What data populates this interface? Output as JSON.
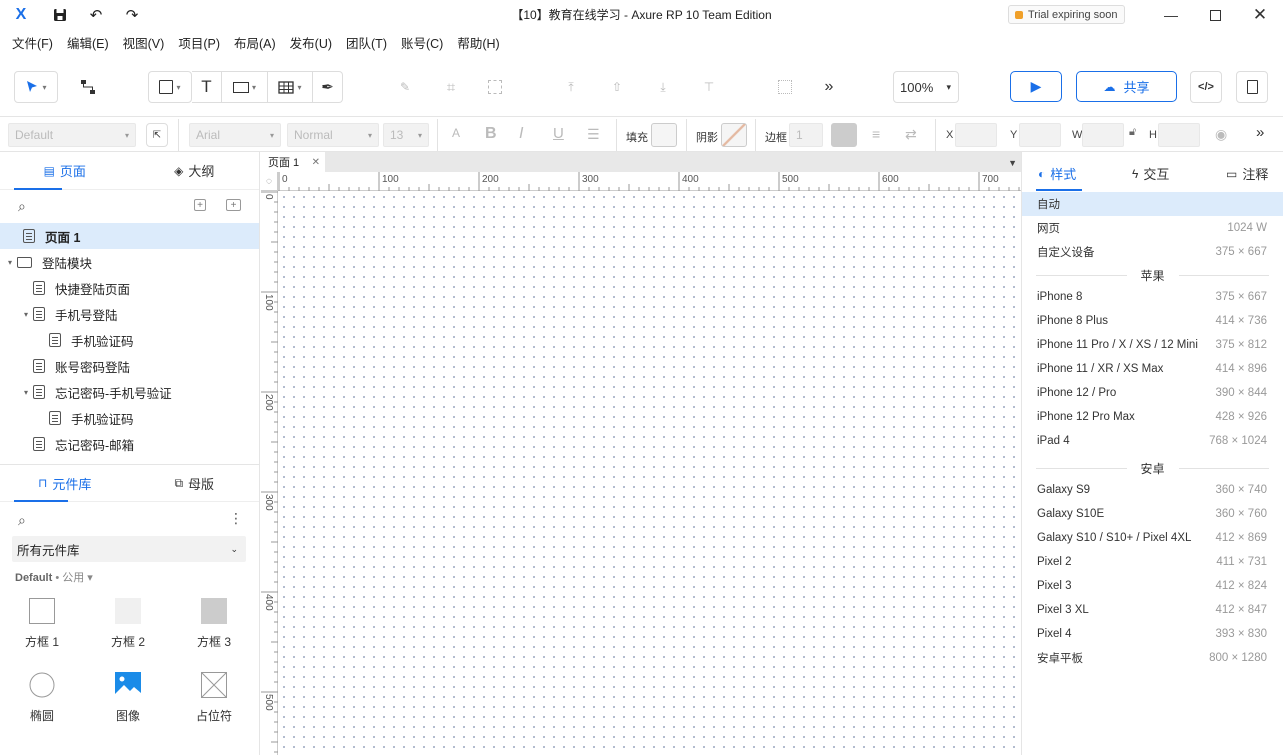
{
  "window": {
    "logo": "X",
    "title": "【10】教育在线学习 - Axure RP 10 Team Edition",
    "trial": "Trial expiring soon",
    "icons": {
      "save": "save-icon",
      "undo": "undo-icon",
      "redo": "redo-icon",
      "minimize": "minimize-icon",
      "maximize": "maximize-icon",
      "close": "close-icon"
    }
  },
  "menu": [
    "文件(F)",
    "编辑(E)",
    "视图(V)",
    "项目(P)",
    "布局(A)",
    "发布(U)",
    "团队(T)",
    "账号(C)",
    "帮助(H)"
  ],
  "toolbar": {
    "more": "»",
    "zoom": "100%",
    "share": "共享"
  },
  "stylebar": {
    "style_select": "Default",
    "font": "Arial",
    "weight": "Normal",
    "size": "13",
    "fill_label": "填充",
    "shadow_label": "阴影",
    "border_label": "边框",
    "border_value": "1",
    "x_label": "X",
    "y_label": "Y",
    "w_label": "W",
    "h_label": "H"
  },
  "pages_panel": {
    "tabs": [
      "页面",
      "大纲"
    ],
    "tree": [
      {
        "label": "页面 1",
        "level": 0,
        "type": "page",
        "selected": true
      },
      {
        "label": "登陆模块",
        "level": 0,
        "type": "folder",
        "toggle": "▾"
      },
      {
        "label": "快捷登陆页面",
        "level": 1,
        "type": "page"
      },
      {
        "label": "手机号登陆",
        "level": 1,
        "type": "page",
        "toggle": "▾"
      },
      {
        "label": "手机验证码",
        "level": 2,
        "type": "page"
      },
      {
        "label": "账号密码登陆",
        "level": 1,
        "type": "page"
      },
      {
        "label": "忘记密码-手机号验证",
        "level": 1,
        "type": "page",
        "toggle": "▾"
      },
      {
        "label": "手机验证码",
        "level": 2,
        "type": "page"
      },
      {
        "label": "忘记密码-邮箱",
        "level": 1,
        "type": "page"
      }
    ]
  },
  "library_panel": {
    "tabs": [
      "元件库",
      "母版"
    ],
    "select": "所有元件库",
    "meta_name": "Default",
    "meta_scope": "• 公用 ▾",
    "widgets": [
      {
        "label": "方框 1",
        "shape": "box1"
      },
      {
        "label": "方框 2",
        "shape": "box2"
      },
      {
        "label": "方框 3",
        "shape": "box3"
      },
      {
        "label": "椭圆",
        "shape": "ellipse"
      },
      {
        "label": "图像",
        "shape": "image"
      },
      {
        "label": "占位符",
        "shape": "placeholder"
      }
    ]
  },
  "canvas": {
    "tab": "页面 1",
    "ruler_h": [
      "0",
      "100",
      "200",
      "300",
      "400",
      "500",
      "600",
      "700"
    ],
    "ruler_v": [
      "0",
      "100",
      "200",
      "300",
      "400",
      "500"
    ]
  },
  "right_panel": {
    "tabs": [
      "样式",
      "交互",
      "注释"
    ],
    "devices_top": [
      {
        "name": "自动",
        "dim": "",
        "selected": true
      },
      {
        "name": "网页",
        "dim": "1024 W"
      },
      {
        "name": "自定义设备",
        "dim": "375 × 667"
      }
    ],
    "group_apple": "苹果",
    "devices_apple": [
      {
        "name": "iPhone 8",
        "dim": "375 × 667"
      },
      {
        "name": "iPhone 8 Plus",
        "dim": "414 × 736"
      },
      {
        "name": "iPhone 11 Pro / X / XS / 12 Mini",
        "dim": "375 × 812"
      },
      {
        "name": "iPhone 11 / XR / XS Max",
        "dim": "414 × 896"
      },
      {
        "name": "iPhone 12 / Pro",
        "dim": "390 × 844"
      },
      {
        "name": "iPhone 12 Pro Max",
        "dim": "428 × 926"
      },
      {
        "name": "iPad 4",
        "dim": "768 × 1024"
      }
    ],
    "group_android": "安卓",
    "devices_android": [
      {
        "name": "Galaxy S9",
        "dim": "360 × 740"
      },
      {
        "name": "Galaxy S10E",
        "dim": "360 × 760"
      },
      {
        "name": "Galaxy S10 / S10+ / Pixel 4XL",
        "dim": "412 × 869"
      },
      {
        "name": "Pixel 2",
        "dim": "411 × 731"
      },
      {
        "name": "Pixel 3",
        "dim": "412 × 824"
      },
      {
        "name": "Pixel 3 XL",
        "dim": "412 × 847"
      },
      {
        "name": "Pixel 4",
        "dim": "393 × 830"
      },
      {
        "name": "安卓平板",
        "dim": "800 × 1280"
      }
    ]
  },
  "colors": {
    "accent": "#1a6fe8",
    "selection": "#dcebfb",
    "trial": "#f0a02a"
  }
}
